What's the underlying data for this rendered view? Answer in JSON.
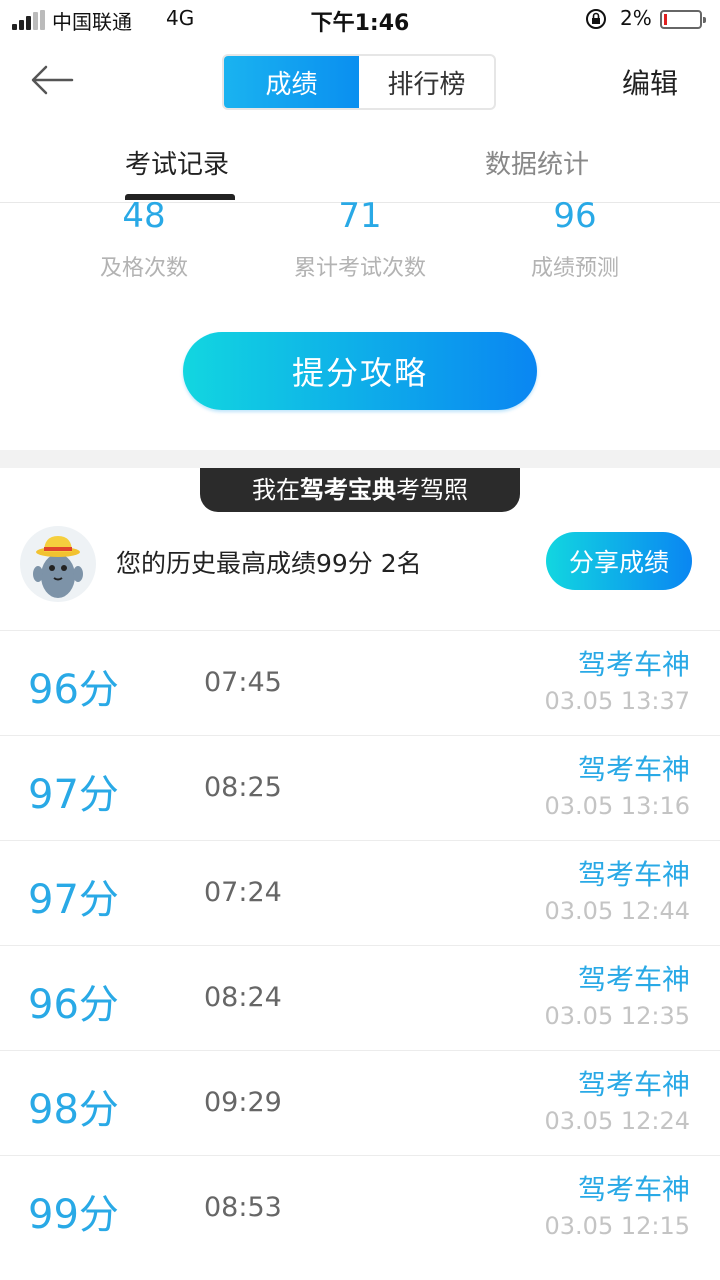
{
  "status_bar": {
    "carrier": "中国联通",
    "network": "4G",
    "time": "下午1:46",
    "battery_percent": "2%"
  },
  "nav": {
    "segments": [
      "成绩",
      "排行榜"
    ],
    "active_segment": "成绩",
    "edit_label": "编辑"
  },
  "sub_tabs": {
    "records_label": "考试记录",
    "stats_label": "数据统计"
  },
  "stats": [
    {
      "value": "48",
      "label": "及格次数"
    },
    {
      "value": "71",
      "label": "累计考试次数"
    },
    {
      "value": "96",
      "label": "成绩预测"
    }
  ],
  "boost_button": "提分攻略",
  "banner": {
    "prefix": "我在",
    "brand": "驾考宝典",
    "suffix": "考驾照"
  },
  "user": {
    "best_text": "您的历史最高成绩99分 2名",
    "share_label": "分享成绩"
  },
  "records": [
    {
      "score": "96分",
      "duration": "07:45",
      "title": "驾考车神",
      "time": "03.05 13:37"
    },
    {
      "score": "97分",
      "duration": "08:25",
      "title": "驾考车神",
      "time": "03.05 13:16"
    },
    {
      "score": "97分",
      "duration": "07:24",
      "title": "驾考车神",
      "time": "03.05 12:44"
    },
    {
      "score": "96分",
      "duration": "08:24",
      "title": "驾考车神",
      "time": "03.05 12:35"
    },
    {
      "score": "98分",
      "duration": "09:29",
      "title": "驾考车神",
      "time": "03.05 12:24"
    },
    {
      "score": "99分",
      "duration": "08:53",
      "title": "驾考车神",
      "time": "03.05 12:15"
    }
  ]
}
